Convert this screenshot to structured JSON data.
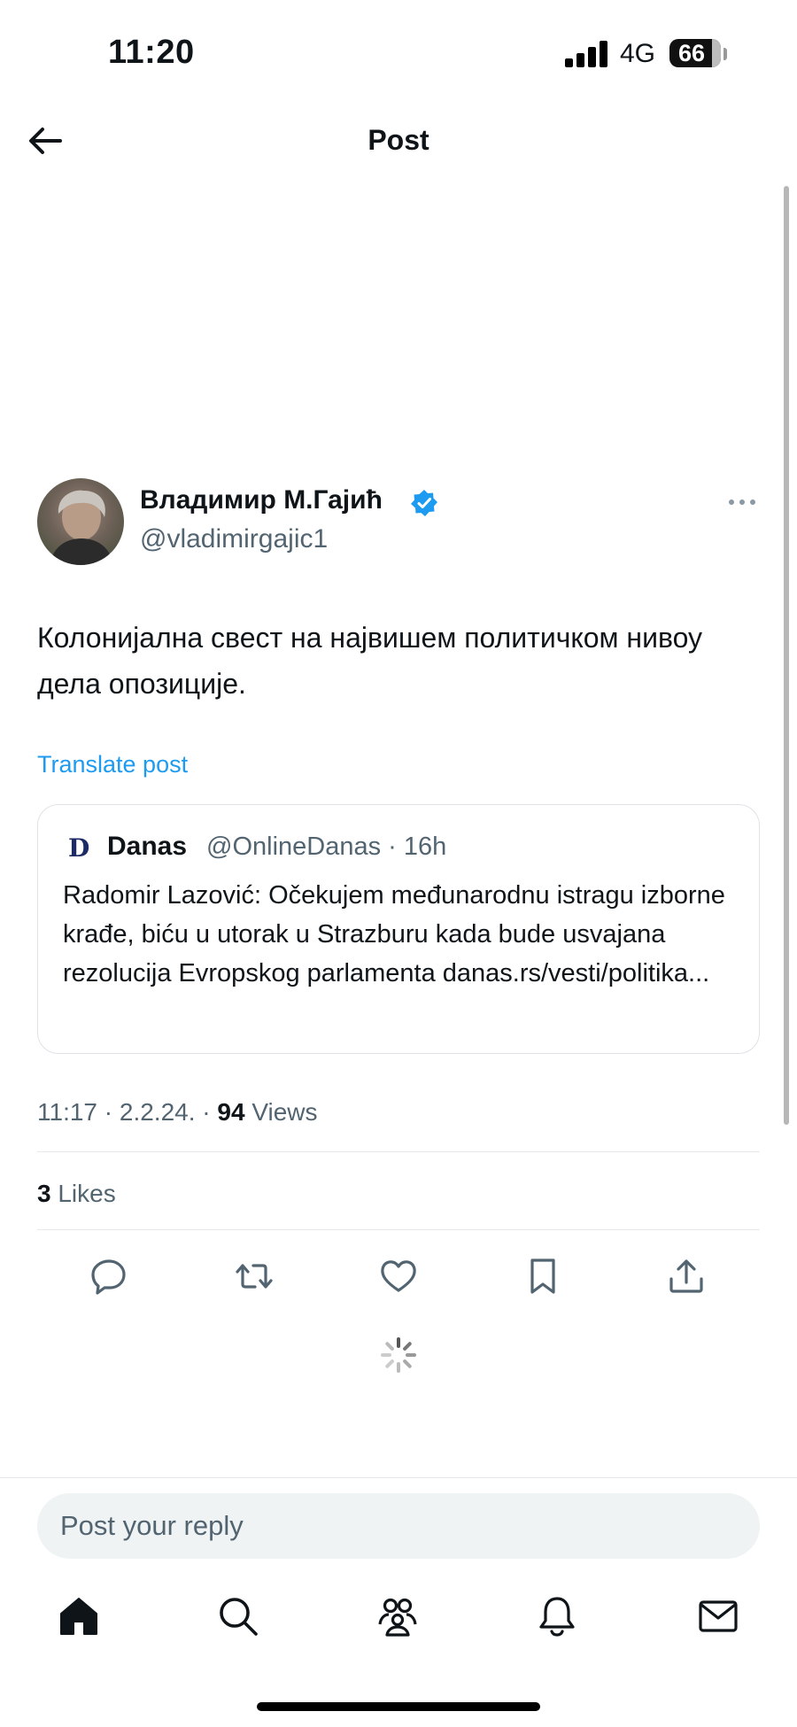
{
  "status_bar": {
    "time": "11:20",
    "network": "4G",
    "battery": "66"
  },
  "header": {
    "title": "Post",
    "back_icon": "arrow-left-icon"
  },
  "post": {
    "author_name": "Владимир М.Гајић",
    "author_handle": "@vladimirgajic1",
    "verified": true,
    "text": "Колонијална свест на највишем политичком нивоу дела опозиције.",
    "translate_label": "Translate post",
    "quote": {
      "logo_letter": "D",
      "name": "Danas",
      "handle_time": "@OnlineDanas · 16h",
      "text": "Radomir Lazović: Očekujem međunarodnu istragu izborne krađe, biću u utorak u Strazburu kada bude usvajana rezolucija Evropskog parlamenta danas.rs/vesti/politika..."
    },
    "timestamp": "11:17 · 2.2.24. · ",
    "views_count": "94",
    "views_label": " Views",
    "likes_count": "3",
    "likes_label": " Likes"
  },
  "actions": [
    "reply-icon",
    "repost-icon",
    "like-icon",
    "bookmark-icon",
    "share-icon"
  ],
  "reply": {
    "placeholder": "Post your reply"
  },
  "nav": [
    "home-icon",
    "search-icon",
    "communities-icon",
    "notifications-icon",
    "messages-icon"
  ],
  "colors": {
    "accent": "#1d9bf0",
    "text_primary": "#0f1419",
    "text_secondary": "#536471"
  }
}
